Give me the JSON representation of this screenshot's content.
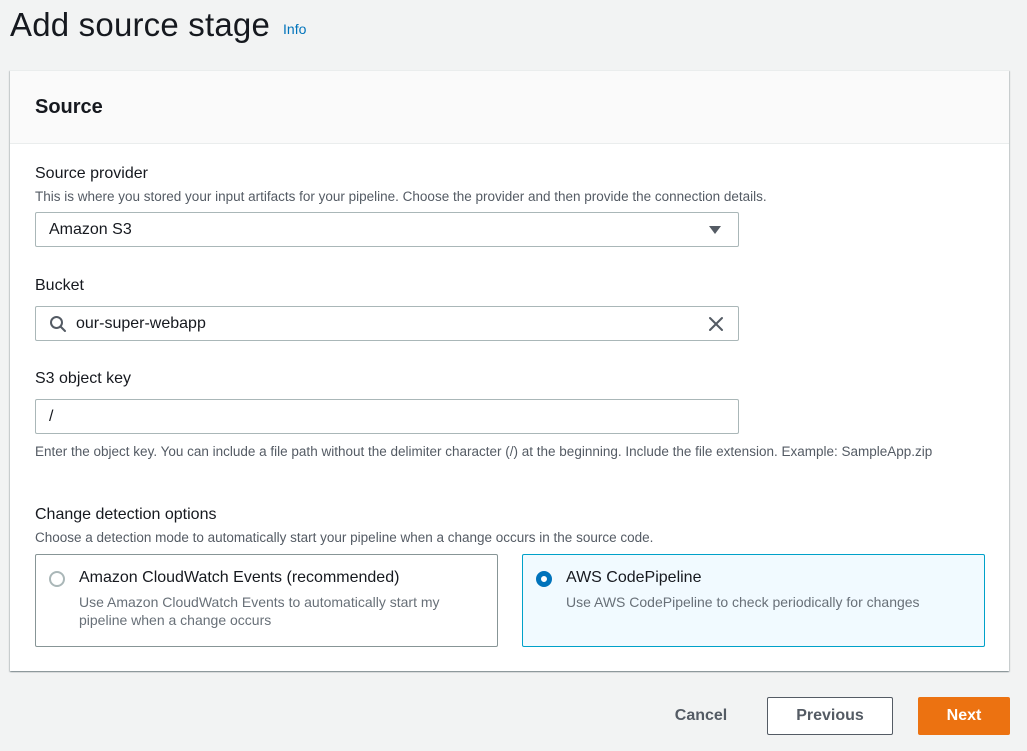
{
  "page": {
    "title": "Add source stage",
    "info_label": "Info"
  },
  "panel": {
    "title": "Source"
  },
  "source_provider": {
    "label": "Source provider",
    "description": "This is where you stored your input artifacts for your pipeline. Choose the provider and then provide the connection details.",
    "selected": "Amazon S3"
  },
  "bucket": {
    "label": "Bucket",
    "value": "our-super-webapp"
  },
  "object_key": {
    "label": "S3 object key",
    "value": "/",
    "help": "Enter the object key. You can include a file path without the delimiter character (/) at the beginning. Include the file extension. Example: SampleApp.zip"
  },
  "change_detection": {
    "label": "Change detection options",
    "description": "Choose a detection mode to automatically start your pipeline when a change occurs in the source code.",
    "options": [
      {
        "title": "Amazon CloudWatch Events (recommended)",
        "description": "Use Amazon CloudWatch Events to automatically start my pipeline when a change occurs",
        "selected": false
      },
      {
        "title": "AWS CodePipeline",
        "description": "Use AWS CodePipeline to check periodically for changes",
        "selected": true
      }
    ]
  },
  "actions": {
    "cancel": "Cancel",
    "previous": "Previous",
    "next": "Next"
  },
  "colors": {
    "accent": "#ec7211",
    "link": "#0073bb",
    "selected_border": "#00a1c9",
    "selected_bg": "#f1faff"
  }
}
